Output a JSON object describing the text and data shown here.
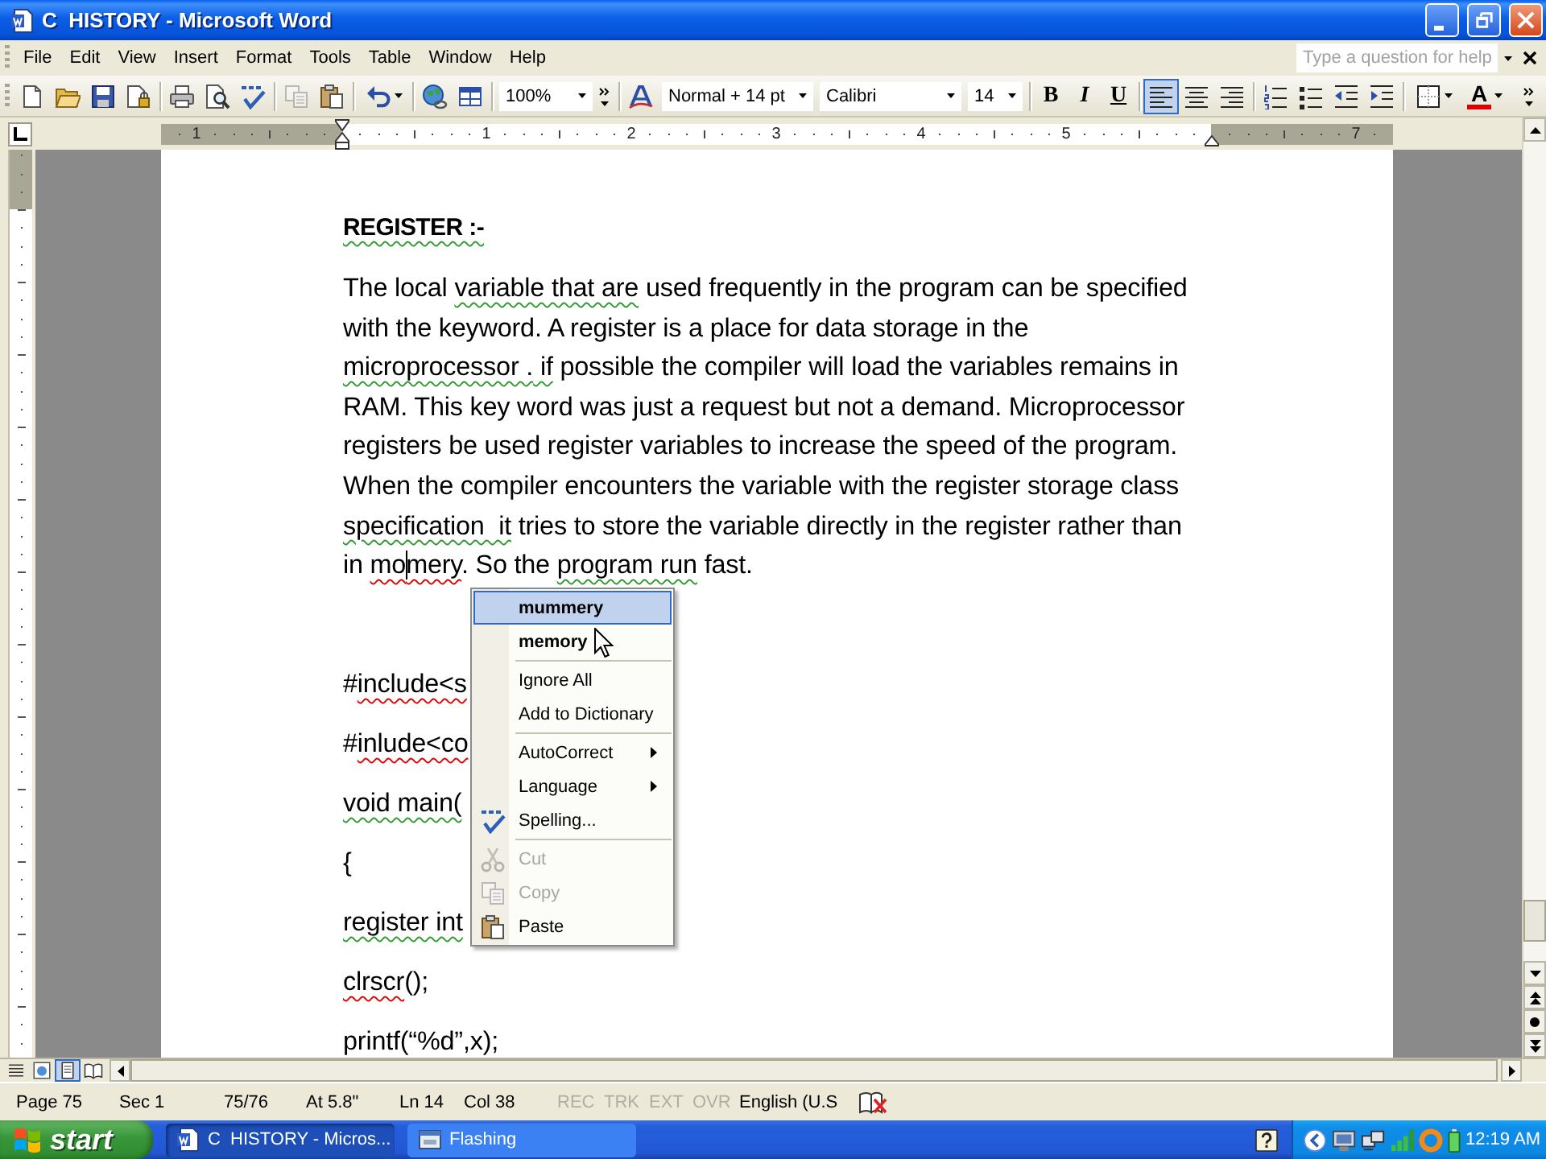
{
  "window": {
    "title": "C  HISTORY - Microsoft Word"
  },
  "menu_bar": {
    "items": [
      "File",
      "Edit",
      "View",
      "Insert",
      "Format",
      "Tools",
      "Table",
      "Window",
      "Help"
    ],
    "help_box": {
      "placeholder": "Type a question for help"
    }
  },
  "standard_toolbar": {
    "groups": [
      [
        {
          "kind": "new",
          "disabled": false
        },
        {
          "kind": "open",
          "disabled": false
        },
        {
          "kind": "save",
          "disabled": false
        },
        {
          "kind": "permission",
          "disabled": false
        }
      ],
      [
        {
          "kind": "print",
          "disabled": false
        },
        {
          "kind": "preview",
          "disabled": false
        },
        {
          "kind": "spelling",
          "disabled": false
        }
      ],
      [
        {
          "kind": "copy",
          "disabled": true
        },
        {
          "kind": "paste",
          "disabled": false
        }
      ],
      [
        {
          "kind": "undo",
          "disabled": false
        }
      ],
      [
        {
          "kind": "hyperlink",
          "disabled": false
        },
        {
          "kind": "tables",
          "disabled": false
        }
      ]
    ],
    "zoom": "100%"
  },
  "formatting_toolbar": {
    "style": "Normal + 14 pt",
    "font": "Calibri",
    "size": "14",
    "text_styles": [
      {
        "label": "B",
        "kind": "bold",
        "selected": false
      },
      {
        "label": "I",
        "kind": "italic",
        "selected": false
      },
      {
        "label": "U",
        "kind": "underline",
        "selected": false
      }
    ],
    "alignment": [
      {
        "kind": "left",
        "selected": true
      },
      {
        "kind": "center",
        "selected": false
      },
      {
        "kind": "right",
        "selected": false
      }
    ],
    "font_color": {
      "label": "A"
    }
  },
  "ruler": {
    "numbers": [
      "1",
      "1",
      "2",
      "3",
      "4",
      "5",
      "7"
    ]
  },
  "document": {
    "heading": [
      {
        "text": "REGISTER :-",
        "grammar_error": true
      }
    ],
    "paragraph": [
      [
        {
          "text": "The local "
        },
        {
          "text": "variable that are",
          "grammar_error": true
        },
        {
          "text": " used frequently in the program can be specified"
        }
      ],
      [
        {
          "text": "with the keyword. A register is a place for data storage in the"
        }
      ],
      [
        {
          "text": "microprocessor .",
          "grammar_error": true
        },
        {
          "text": " if",
          "grammar_error": true
        },
        {
          "text": " possible the compiler will load the variables remains in"
        }
      ],
      [
        {
          "text": "RAM. This key word was just a request but not a demand. Microprocessor"
        }
      ],
      [
        {
          "text": "registers be used register variables to increase the speed of the program."
        }
      ],
      [
        {
          "text": "When the compiler encounters the variable with the register storage class"
        }
      ],
      [
        {
          "text": "specification  it",
          "grammar_error": true
        },
        {
          "text": " tries to store the variable directly in the register rather than"
        }
      ],
      [
        {
          "text": "in "
        },
        {
          "text": "mo",
          "spelling_error": true
        },
        {
          "text": "mery",
          "spelling_error": true,
          "caret": true
        },
        {
          "text": ". So the "
        },
        {
          "text": "program run",
          "grammar_error": true
        },
        {
          "text": " fast."
        }
      ]
    ],
    "code_lines": [
      [
        {
          "text": "#"
        },
        {
          "text": "include<s",
          "spelling_error": true
        }
      ],
      [
        {
          "text": "#"
        },
        {
          "text": "inlude<co",
          "spelling_error": true
        }
      ],
      [
        {
          "text": "void main(",
          "grammar_error": true
        }
      ],
      [
        {
          "text": "{"
        }
      ],
      [
        {
          "text": "register int",
          "grammar_error": true
        }
      ],
      [
        {
          "text": "clrscr",
          "spelling_error": true
        },
        {
          "text": "();"
        }
      ],
      [
        {
          "text": "printf(“%d”,x);"
        }
      ]
    ]
  },
  "context_menu": {
    "items": [
      {
        "kind": "suggestion",
        "label": "mummery",
        "selected": true,
        "disabled": false
      },
      {
        "kind": "suggestion",
        "label": "memory",
        "selected": false,
        "disabled": false
      },
      {
        "kind": "separator"
      },
      {
        "kind": "command",
        "label": "Ignore All",
        "selected": false,
        "disabled": false
      },
      {
        "kind": "command",
        "label": "Add to Dictionary",
        "selected": false,
        "disabled": false
      },
      {
        "kind": "separator"
      },
      {
        "kind": "submenu",
        "label": "AutoCorrect",
        "selected": false,
        "disabled": false
      },
      {
        "kind": "submenu",
        "label": "Language",
        "selected": false,
        "disabled": false
      },
      {
        "kind": "spelling",
        "label": "Spelling...",
        "selected": false,
        "disabled": false
      },
      {
        "kind": "separator"
      },
      {
        "kind": "cut",
        "label": "Cut",
        "selected": false,
        "disabled": true
      },
      {
        "kind": "copy",
        "label": "Copy",
        "selected": false,
        "disabled": true
      },
      {
        "kind": "paste",
        "label": "Paste",
        "selected": false,
        "disabled": false
      }
    ]
  },
  "view_buttons": [
    {
      "kind": "normal",
      "selected": false
    },
    {
      "kind": "web",
      "selected": false
    },
    {
      "kind": "print",
      "selected": true
    },
    {
      "kind": "reading",
      "selected": false
    }
  ],
  "status_bar": {
    "fields": [
      "Page 75",
      "Sec 1",
      "75/76",
      "At 5.8\"",
      "Ln 14",
      "Col 38"
    ],
    "modes": [
      {
        "label": "REC",
        "on": false
      },
      {
        "label": "TRK",
        "on": false
      },
      {
        "label": "EXT",
        "on": false
      },
      {
        "label": "OVR",
        "on": false
      }
    ],
    "language": "English (U.S"
  },
  "taskbar": {
    "start": "start",
    "tasks": [
      {
        "label": "C  HISTORY - Micros...",
        "kind": "document",
        "selected": true
      },
      {
        "label": "Flashing",
        "kind": "window",
        "selected": false
      }
    ],
    "clock": "12:19 AM"
  }
}
